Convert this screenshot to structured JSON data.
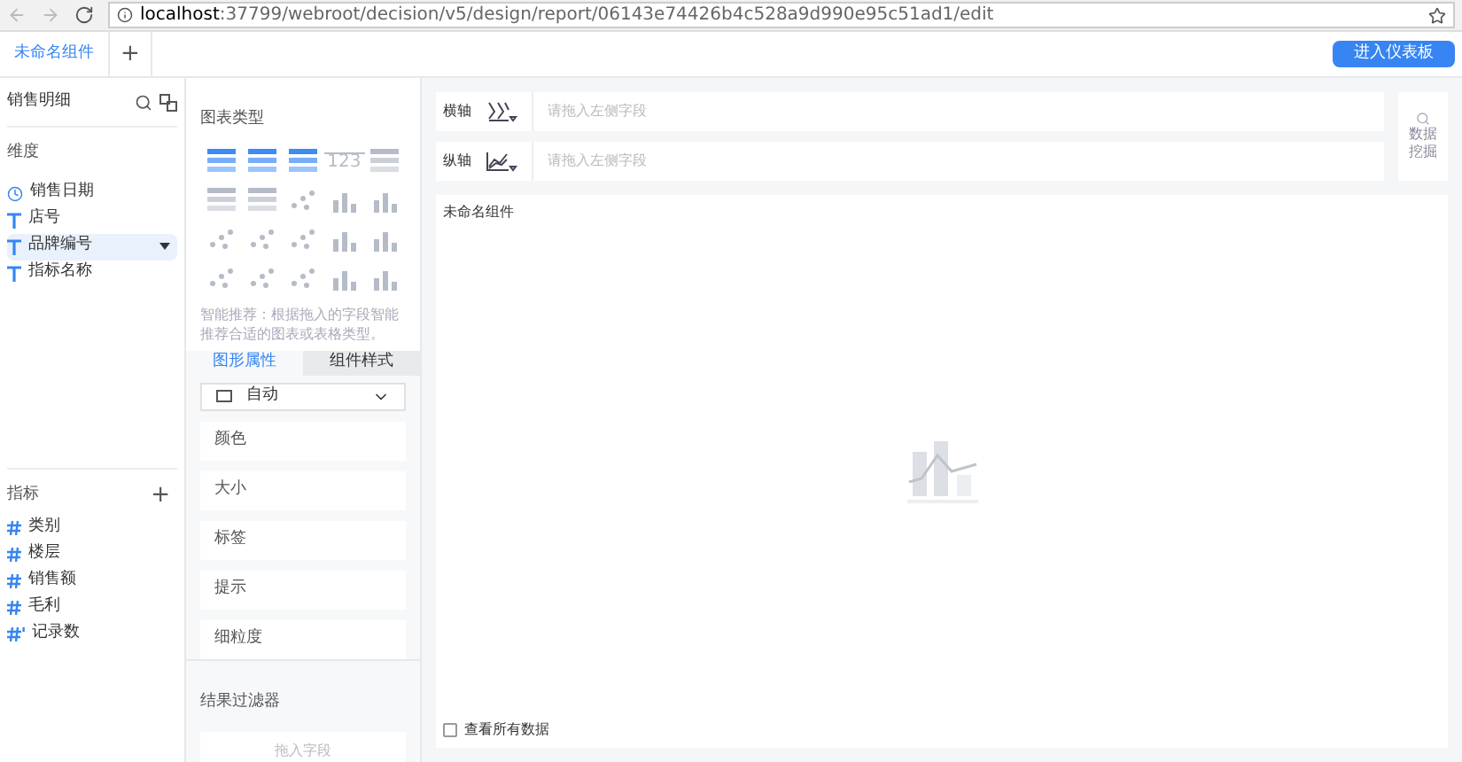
{
  "browser": {
    "url_host": "localhost",
    "url_rest": ":37799/webroot/decision/v5/design/report/06143e74426b4c528a9d990e95c51ad1/edit"
  },
  "tabs": [
    {
      "label": "未命名组件",
      "selected": true
    }
  ],
  "tab_add": "+",
  "dashboard_button": "进入仪表板",
  "dataset": {
    "title": "销售明细"
  },
  "dimensions": {
    "title": "维度",
    "items": [
      {
        "label": "销售日期",
        "kind": "date",
        "selected": false
      },
      {
        "label": "店号",
        "kind": "text",
        "selected": false
      },
      {
        "label": "品牌编号",
        "kind": "text",
        "selected": true
      },
      {
        "label": "指标名称",
        "kind": "text",
        "selected": false
      }
    ]
  },
  "measures": {
    "title": "指标",
    "add": "+",
    "items": [
      {
        "label": "类别",
        "kind": "number"
      },
      {
        "label": "楼层",
        "kind": "number"
      },
      {
        "label": "销售额",
        "kind": "number"
      },
      {
        "label": "毛利",
        "kind": "number"
      },
      {
        "label": "记录数",
        "kind": "count"
      }
    ]
  },
  "chart_types": {
    "title": "图表类型",
    "items": [
      {
        "enabled": true
      },
      {
        "enabled": true
      },
      {
        "enabled": true
      },
      {
        "enabled": false,
        "label": "123"
      },
      {
        "enabled": false
      },
      {
        "enabled": false
      },
      {
        "enabled": false
      },
      {
        "enabled": false
      },
      {
        "enabled": false
      },
      {
        "enabled": false
      },
      {
        "enabled": false
      },
      {
        "enabled": false
      },
      {
        "enabled": false
      },
      {
        "enabled": false
      },
      {
        "enabled": false
      },
      {
        "enabled": false
      },
      {
        "enabled": false
      },
      {
        "enabled": false
      },
      {
        "enabled": false
      },
      {
        "enabled": false
      }
    ],
    "hint": "智能推荐：根据拖入的字段智能推荐合适的图表或表格类型。"
  },
  "property_tabs": [
    {
      "label": "图形属性",
      "selected": true
    },
    {
      "label": "组件样式",
      "selected": false
    }
  ],
  "shape_select": "自动",
  "properties": [
    "颜色",
    "大小",
    "标签",
    "提示",
    "细粒度"
  ],
  "filter": {
    "title": "结果过滤器",
    "placeholder": "拖入字段"
  },
  "axes": [
    {
      "label": "横轴",
      "placeholder": "请拖入左侧字段"
    },
    {
      "label": "纵轴",
      "placeholder": "请拖入左侧字段"
    }
  ],
  "data_mining": "数据挖掘",
  "canvas": {
    "title": "未命名组件",
    "show_all": {
      "label": "查看所有数据",
      "checked": false
    }
  }
}
